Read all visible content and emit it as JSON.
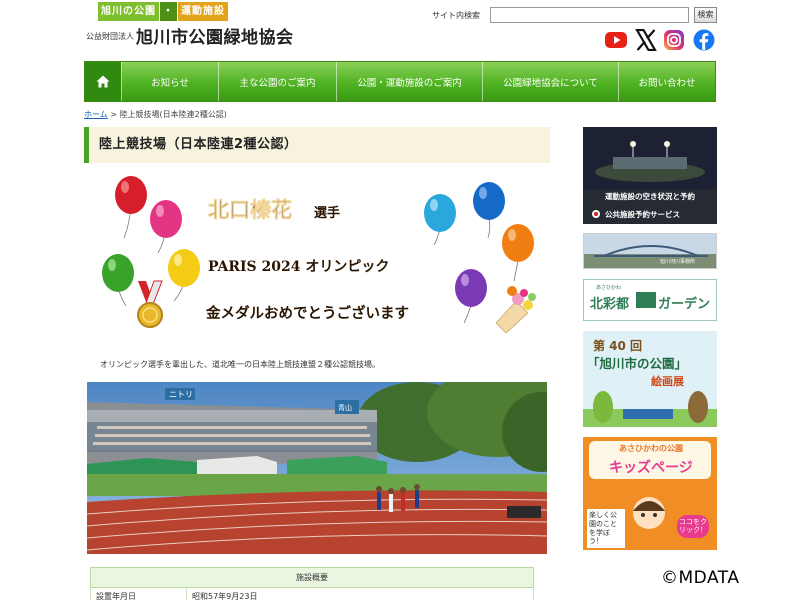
{
  "header": {
    "tagline_a": "旭川の公園",
    "tagline_dot": "・",
    "tagline_b": "運動施設",
    "org_small": "公益財団法人",
    "org_name": "旭川市公園緑地協会",
    "search_label": "サイト内検索",
    "search_value": "",
    "search_button": "検索",
    "sns": [
      "youtube-icon",
      "x-icon",
      "instagram-icon",
      "facebook-icon"
    ]
  },
  "nav": {
    "home_icon": "home-icon",
    "items": [
      "お知らせ",
      "主な公園のご案内",
      "公園・運動施設のご案内",
      "公園緑地協会について",
      "お問い合わせ"
    ]
  },
  "breadcrumb": {
    "home": "ホーム",
    "separator": ">",
    "current": "陸上競技場(日本陸連2種公認)"
  },
  "page": {
    "title": "陸上競技場（日本陸連2種公認）",
    "banner": {
      "name": "北口榛花",
      "honorific": "選手",
      "event": "PARIS 2024 オリンピック",
      "message": "金メダルおめでとうございます"
    },
    "caption": "オリンピック選手を輩出した、道北唯一の日本陸上競技連盟２種公認競技場。",
    "photo_signs": [
      "ニトリ",
      "青山"
    ]
  },
  "facility": {
    "header": "施設概要",
    "rows": [
      {
        "label": "設置年月日",
        "value": "昭和57年9月23日"
      }
    ]
  },
  "sidebar": {
    "reservation_line1": "運動施設の空き状況と予約",
    "reservation_line2": "公共施設予約サービス",
    "bridge_caption": "旭川河川事務所",
    "kitasaito_small": "あさひかわ",
    "kitasaito": "北彩都",
    "garden": "ガーデン",
    "contest_number": "第 40 回",
    "contest_title": "「旭川市の公園」",
    "contest_sub": "絵画展",
    "kids_top": "あさひかわの公園",
    "kids_title": "キッズページ",
    "kids_learn": "楽しく公園のことを学ぼう！",
    "kids_click": "ココをクリック！"
  },
  "copyright": "©MDATA",
  "colors": {
    "nav_green": "#4fb222",
    "title_bg": "#f7f3df",
    "link": "#1a5fb4",
    "banner_text": "#2a1500",
    "kids_orange": "#f08d24"
  }
}
